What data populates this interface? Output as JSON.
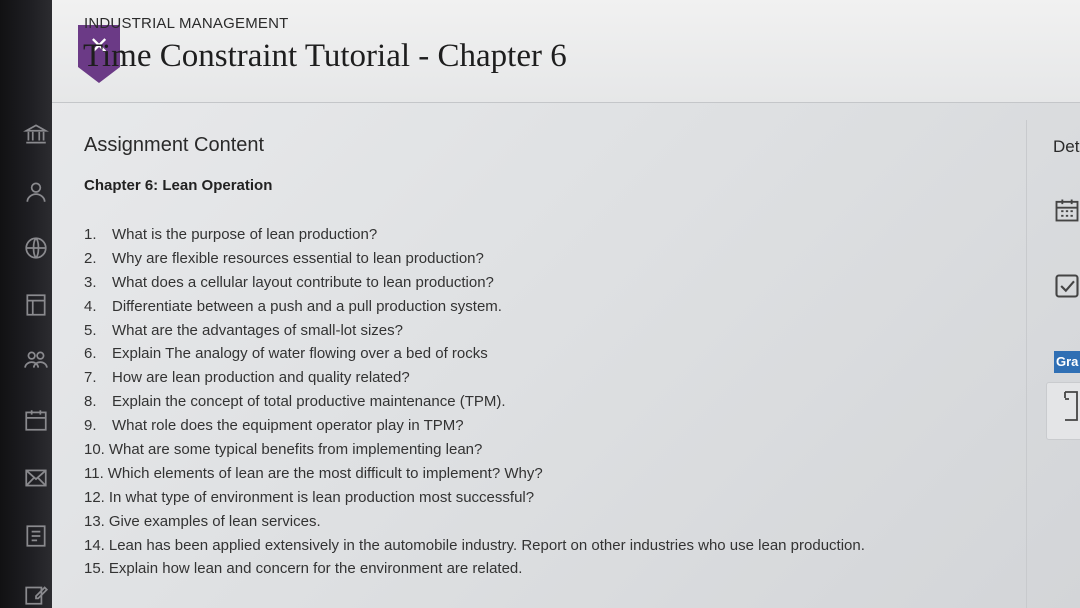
{
  "header": {
    "course_name": "INDUSTRIAL MANAGEMENT",
    "title": "Time Constraint Tutorial - Chapter 6",
    "close_icon": "close-icon",
    "accent_color": "#6b3a86"
  },
  "sidebar": {
    "icons": [
      "institution-icon",
      "profile-icon",
      "globe-icon",
      "courses-icon",
      "groups-icon",
      "calendar-icon",
      "messages-icon",
      "grades-icon",
      "edit-icon"
    ]
  },
  "content": {
    "section_heading": "Assignment Content",
    "chapter_title": "Chapter 6: Lean Operation",
    "questions": [
      {
        "num": "1.",
        "text": "What is the purpose of lean production?"
      },
      {
        "num": "2.",
        "text": "Why are flexible resources essential to lean production?"
      },
      {
        "num": "3.",
        "text": "What does a cellular layout contribute to lean production?"
      },
      {
        "num": "4.",
        "text": "Differentiate between a push and a pull production system."
      },
      {
        "num": "5.",
        "text": "What are the advantages of small-lot sizes?"
      },
      {
        "num": "6.",
        "text": "Explain The analogy of water flowing over a bed of rocks"
      },
      {
        "num": "7.",
        "text": "How are lean production and quality related?"
      },
      {
        "num": "8.",
        "text": "Explain the concept of total productive maintenance (TPM)."
      },
      {
        "num": "9.",
        "text": "What role does the equipment operator play in TPM?"
      },
      {
        "num": "10.",
        "text": "What are some typical benefits from implementing lean?"
      },
      {
        "num": "11.",
        "text": "Which elements of lean are the most difficult to implement? Why?"
      },
      {
        "num": "12.",
        "text": "In what type of environment is lean production most successful?"
      },
      {
        "num": "13.",
        "text": "Give examples of lean services."
      },
      {
        "num": "14.",
        "text": "Lean has been applied extensively in the automobile industry. Report on other industries who use lean production."
      },
      {
        "num": "15.",
        "text": "Explain how lean and concern for the environment are related."
      }
    ]
  },
  "right_panel": {
    "label": "Det",
    "grade_label": "Gra",
    "icons": [
      "calendar-icon",
      "checkbox-icon",
      "document-icon"
    ]
  }
}
